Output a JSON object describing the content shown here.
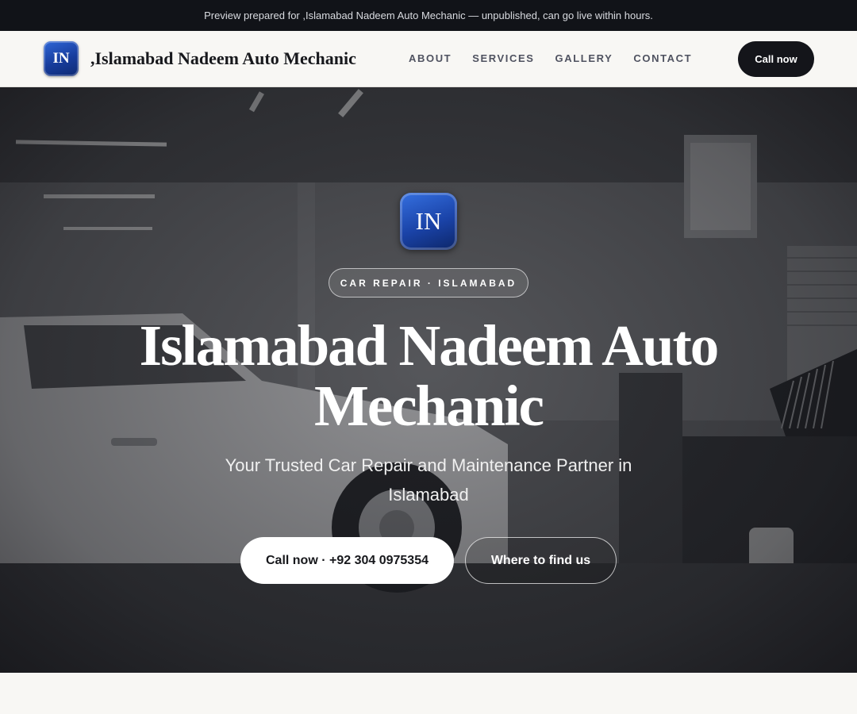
{
  "preview_bar": {
    "text": "Preview prepared for ,Islamabad Nadeem Auto Mechanic — unpublished, can go live within hours."
  },
  "nav": {
    "logo_text": "IN",
    "brand": ",Islamabad Nadeem Auto Mechanic",
    "links": [
      {
        "label": "ABOUT"
      },
      {
        "label": "SERVICES"
      },
      {
        "label": "GALLERY"
      },
      {
        "label": "CONTACT"
      }
    ],
    "call_label": "Call now"
  },
  "hero": {
    "logo_text": "IN",
    "badge": "CAR REPAIR · ISLAMABAD",
    "title": "Islamabad Nadeem Auto Mechanic",
    "subtitle": "Your Trusted Car Repair and Maintenance Partner in Islamabad",
    "primary_cta": "Call now · +92 304 0975354",
    "secondary_cta": "Where to find us",
    "background_image": "grayscale photo of a car repair garage with a white sedan and tool cabinets"
  },
  "colors": {
    "preview_bar_bg": "#111318",
    "page_bg": "#f8f7f4",
    "dark_button": "#14151a",
    "logo_blue": "#1a43a8"
  }
}
